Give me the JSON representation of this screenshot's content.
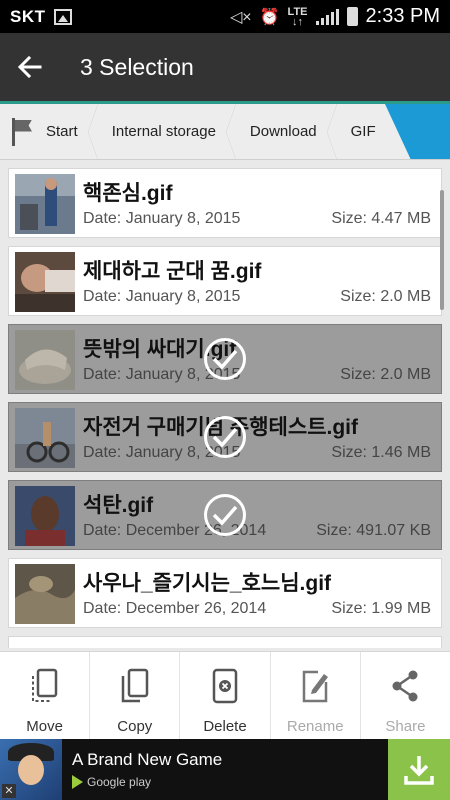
{
  "status_bar": {
    "carrier": "SKT",
    "network": "LTE",
    "time": "2:33 PM"
  },
  "header": {
    "title": "3 Selection",
    "back_icon": "arrow-back-icon"
  },
  "breadcrumb": {
    "items": [
      "Start",
      "Internal storage",
      "Download",
      "GIF"
    ],
    "active_index": 3
  },
  "files": [
    {
      "name": "핵존심.gif",
      "date": "Date: January 8, 2015",
      "size": "Size: 4.47 MB",
      "selected": false
    },
    {
      "name": "제대하고 군대 꿈.gif",
      "date": "Date: January 8, 2015",
      "size": "Size: 2.0 MB",
      "selected": false
    },
    {
      "name": "뜻밖의 싸대기.gif",
      "date": "Date: January 8, 2015",
      "size": "Size: 2.0 MB",
      "selected": true
    },
    {
      "name": "자전거 구매기념 주행테스트.gif",
      "date": "Date: January 8, 2015",
      "size": "Size: 1.46 MB",
      "selected": true
    },
    {
      "name": "석탄.gif",
      "date": "Date: December 26, 2014",
      "size": "Size: 491.07 KB",
      "selected": true
    },
    {
      "name": "사우나_즐기시는_호느님.gif",
      "date": "Date: December 26, 2014",
      "size": "Size: 1.99 MB",
      "selected": false
    }
  ],
  "toolbar": {
    "move": "Move",
    "copy": "Copy",
    "delete": "Delete",
    "rename": "Rename",
    "share": "Share"
  },
  "ad": {
    "title": "A Brand New Game",
    "store": "Google play",
    "close": "✕"
  },
  "colors": {
    "accent": "#1b9ad6",
    "teal_line": "#2a9a8a",
    "selected_bg": "#9c9c9c",
    "download_green": "#8bc34a"
  }
}
